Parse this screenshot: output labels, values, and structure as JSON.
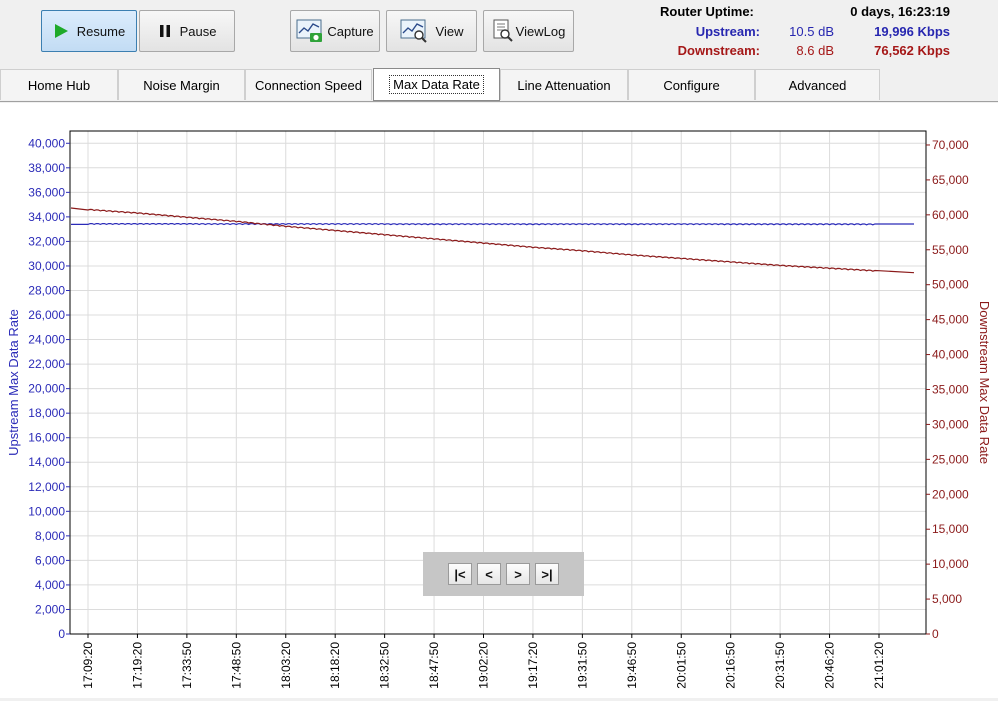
{
  "toolbar": {
    "resume_label": "Resume",
    "pause_label": "Pause",
    "capture_label": "Capture",
    "view_label": "View",
    "viewlog_label": "ViewLog"
  },
  "status": {
    "uptime_label": "Router Uptime:",
    "uptime_value": "0 days, 16:23:19",
    "upstream_label": "Upstream:",
    "upstream_db": "10.5 dB",
    "upstream_kbps": "19,996 Kbps",
    "downstream_label": "Downstream:",
    "downstream_db": "8.6 dB",
    "downstream_kbps": "76,562 Kbps"
  },
  "tabs": [
    "Home Hub",
    "Noise Margin",
    "Connection Speed",
    "Max Data Rate",
    "Line Attenuation",
    "Configure",
    "Advanced"
  ],
  "selected_tab": "Max Data Rate",
  "colors": {
    "upstream": "#2b2bb8",
    "downstream": "#8b1a1a",
    "grid": "#dcdcdc"
  },
  "nav": {
    "first": "|<",
    "prev": "<",
    "next": ">",
    "last": ">|"
  },
  "chart_data": {
    "type": "line",
    "title": "",
    "ylabel": "Upstream Max Data Rate",
    "y2label": "Downstream Max Data Rate",
    "ylim": [
      0,
      41000
    ],
    "y2lim": [
      0,
      72000
    ],
    "yticks": [
      "0",
      "2,000",
      "4,000",
      "6,000",
      "8,000",
      "10,000",
      "12,000",
      "14,000",
      "16,000",
      "18,000",
      "20,000",
      "22,000",
      "24,000",
      "26,000",
      "28,000",
      "30,000",
      "32,000",
      "34,000",
      "36,000",
      "38,000",
      "40,000"
    ],
    "y2ticks": [
      "0",
      "5,000",
      "10,000",
      "15,000",
      "20,000",
      "25,000",
      "30,000",
      "35,000",
      "40,000",
      "45,000",
      "50,000",
      "55,000",
      "60,000",
      "65,000",
      "70,000"
    ],
    "x": [
      "17:09:20",
      "17:19:20",
      "17:33:50",
      "17:48:50",
      "18:03:20",
      "18:18:20",
      "18:32:50",
      "18:47:50",
      "19:02:20",
      "19:17:20",
      "19:31:50",
      "19:46:50",
      "20:01:50",
      "20:16:50",
      "20:31:50",
      "20:46:20",
      "21:01:20"
    ],
    "grid": true,
    "series": [
      {
        "name": "Upstream Max Data Rate",
        "axis": "left",
        "values": [
          33450,
          33450,
          33450,
          33440,
          33440,
          33440,
          33440,
          33430,
          33440,
          33430,
          33440,
          33430,
          33440,
          33430,
          33430,
          33430,
          33420
        ]
      },
      {
        "name": "Downstream Max Data Rate",
        "axis": "right",
        "values": [
          60800,
          60300,
          59700,
          59100,
          58400,
          57800,
          57200,
          56600,
          56000,
          55400,
          54900,
          54300,
          53800,
          53300,
          52800,
          52400,
          52000
        ]
      }
    ]
  }
}
